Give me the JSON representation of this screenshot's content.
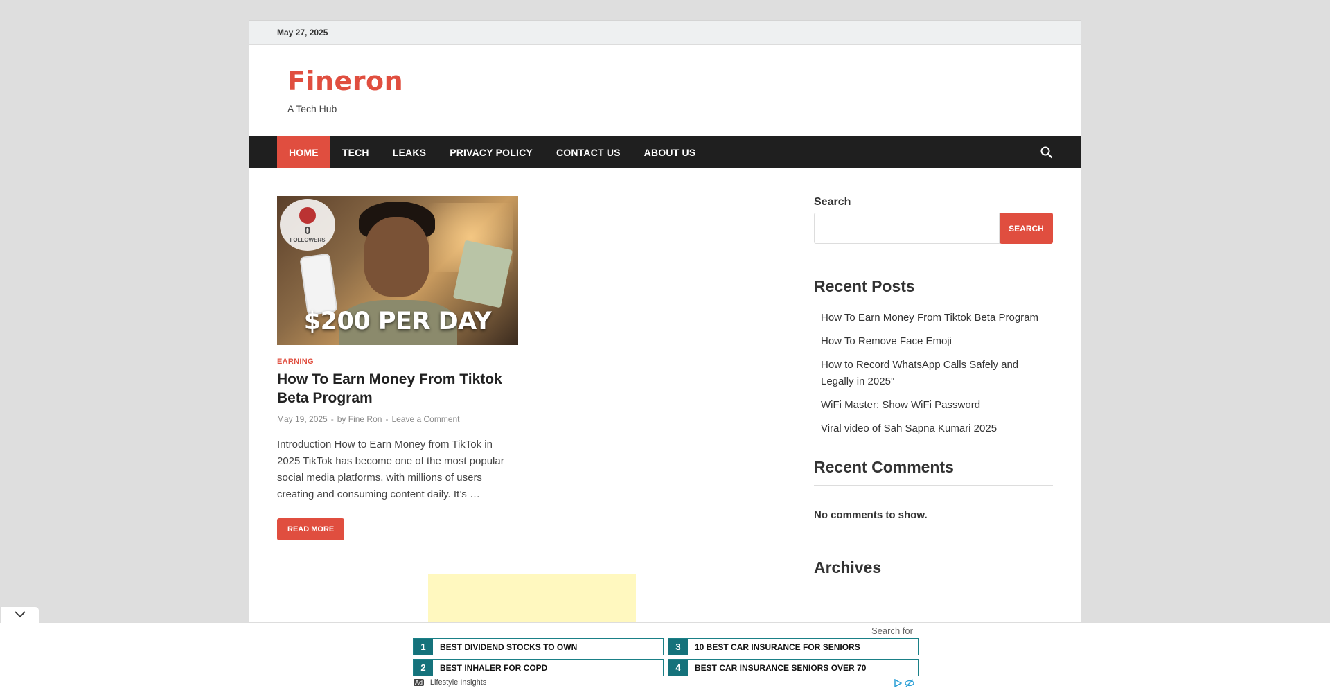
{
  "topbar": {
    "date": "May 27, 2025"
  },
  "site": {
    "title": "Fineron",
    "tagline": "A Tech Hub"
  },
  "nav": {
    "items": [
      "HOME",
      "TECH",
      "LEAKS",
      "PRIVACY POLICY",
      "CONTACT US",
      "ABOUT US"
    ],
    "active": "HOME"
  },
  "post": {
    "thumbnail": {
      "badge_count": "0",
      "badge_label": "FOLLOWERS",
      "caption": "$200 PER DAY"
    },
    "category": "EARNING",
    "title": "How To Earn Money From Tiktok Beta Program",
    "date": "May 19, 2025",
    "sep": "-",
    "by": "by",
    "author": "Fine Ron",
    "comments_link": "Leave a Comment",
    "excerpt": "Introduction How to Earn Money from TikTok in 2025 TikTok has become one of the most popular social media platforms, with millions of users creating and consuming content daily. It’s …",
    "read_more": "READ MORE"
  },
  "sidebar": {
    "search_label": "Search",
    "search_value": "",
    "search_button": "SEARCH",
    "recent_posts_title": "Recent Posts",
    "recent_posts": [
      "How To Earn Money From Tiktok Beta Program",
      "How To Remove Face Emoji",
      "How to Record WhatsApp Calls Safely and Legally in 2025”",
      "WiFi Master: Show WiFi Password",
      "Viral video of Sah Sapna Kumari 2025"
    ],
    "recent_comments_title": "Recent Comments",
    "no_comments": "No comments to show.",
    "archives_title": "Archives"
  },
  "anchor_ad": {
    "search_for": "Search for",
    "items": [
      {
        "num": "1",
        "text": "BEST DIVIDEND STOCKS TO OWN"
      },
      {
        "num": "2",
        "text": "BEST INHALER FOR COPD"
      },
      {
        "num": "3",
        "text": "10 BEST CAR INSURANCE FOR SENIORS"
      },
      {
        "num": "4",
        "text": "BEST CAR INSURANCE SENIORS OVER 70"
      }
    ],
    "arrow_glyph": "",
    "ad_tag": "Ad",
    "footer": "| Lifestyle Insights"
  },
  "colors": {
    "accent": "#e04e3f",
    "nav_bg": "#1f1f1f",
    "ad_teal": "#15727b"
  }
}
